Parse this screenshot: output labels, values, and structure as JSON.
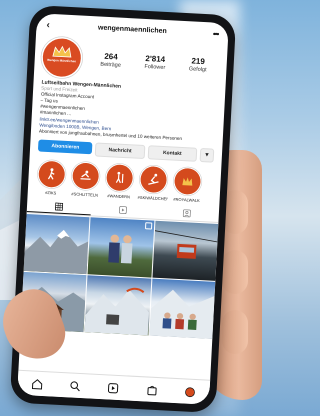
{
  "profile": {
    "username": "wengenmaennlichen",
    "logo_text": "Wengen Männlichen"
  },
  "stats": [
    {
      "num": "264",
      "label": "Beiträge"
    },
    {
      "num": "2'814",
      "label": "Follower"
    },
    {
      "num": "219",
      "label": "Gefolgt"
    }
  ],
  "bio": {
    "name": "Luftseilbahn Wengen-Männlichen",
    "category": "Sport und Freizeit",
    "line1": "Official Instagram Account",
    "line2": "– Tag us",
    "line3": "#wengenmaennlichen",
    "line4": "#mannlichen ...",
    "link": "linktr.ee/wengenmaennlichen",
    "address": "Wengiboden 1000B, Wengen, Bern",
    "followed_by": "Abonniert von jungfraubahnen, brusmhertel und 10 weiteren Personen"
  },
  "buttons": {
    "follow": "Abonnieren",
    "message": "Nachricht",
    "contact": "Kontakt",
    "more": "▾"
  },
  "highlights": [
    {
      "label": "#ZIKS",
      "icon": "hiker-icon"
    },
    {
      "label": "#SCHLITTELN",
      "icon": "sled-icon"
    },
    {
      "label": "#WANDERN",
      "icon": "hiking-icon"
    },
    {
      "label": "#SKIWÄLDCHEN",
      "icon": "ski-icon"
    },
    {
      "label": "#ROYALWALK",
      "icon": "crown-icon"
    }
  ],
  "tabs": [
    {
      "icon": "grid-icon",
      "active": true
    },
    {
      "icon": "reels-icon",
      "active": false
    },
    {
      "icon": "tagged-icon",
      "active": false
    }
  ],
  "grid": [
    {
      "icon": "mountain-photo"
    },
    {
      "icon": "couple-photo"
    },
    {
      "icon": "gondola-photo"
    },
    {
      "icon": "hut-photo"
    },
    {
      "icon": "paraglider-photo"
    },
    {
      "icon": "group-photo"
    }
  ],
  "colors": {
    "brand": "#d44a1d",
    "primary_button": "#1f8de6"
  }
}
